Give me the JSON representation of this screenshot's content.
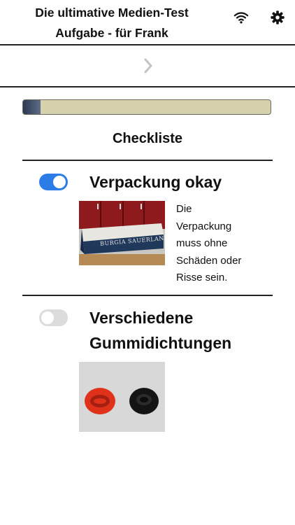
{
  "header": {
    "title_line1": "Die ultimative Medien-Test",
    "title_line2": "Aufgabe - für Frank",
    "wifi_icon": "wifi-icon",
    "settings_icon": "gear-icon"
  },
  "nav": {
    "next_icon": "chevron-right-icon"
  },
  "progress": {
    "value_percent": 7,
    "colors": {
      "fill": "#2b3952",
      "track": "#d6d1ad"
    }
  },
  "checklist": {
    "title": "Checkliste",
    "items": [
      {
        "title": "Verpackung okay",
        "checked": true,
        "description": [
          "Die",
          "Verpackung",
          "muss ohne",
          "Schäden oder",
          "Risse sein."
        ],
        "image_alt": "BURGIA SAUERLAND"
      },
      {
        "title_line1": "Verschiedene",
        "title_line2": "Gummidichtungen",
        "checked": false
      }
    ]
  },
  "colors": {
    "toggle_on": "#2c7ce8",
    "toggle_off": "#dcdcdc"
  }
}
